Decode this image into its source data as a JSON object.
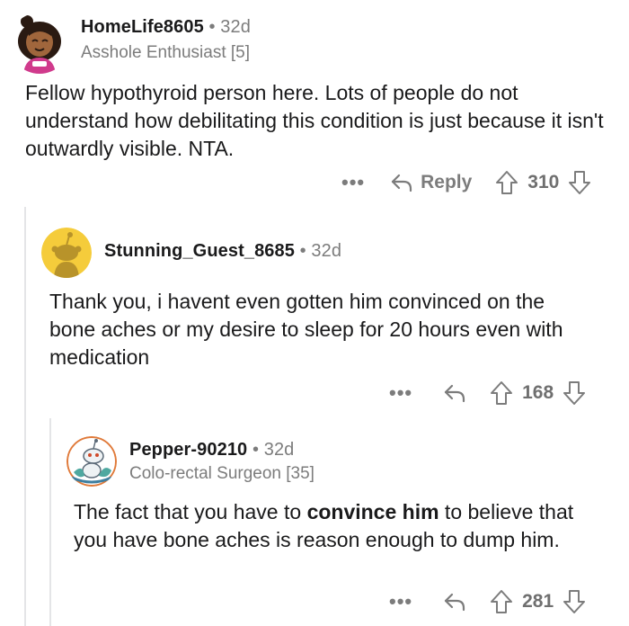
{
  "comments": [
    {
      "username": "HomeLife8605",
      "separator": "•",
      "age": "32d",
      "flair": "Asshole Enthusiast [5]",
      "body": "Fellow hypothyroid person here. Lots of people do not understand how debilitating this condition is just because it isn't outwardly visible. NTA.",
      "more_label": "•••",
      "reply_label": "Reply",
      "score": "310"
    },
    {
      "username": "Stunning_Guest_8685",
      "separator": "•",
      "age": "32d",
      "body": "Thank you, i havent even gotten him convinced on the bone aches or my desire to sleep for 20 hours even with medication",
      "more_label": "•••",
      "score": "168"
    },
    {
      "username": "Pepper-90210",
      "separator": "•",
      "age": "32d",
      "flair": "Colo-rectal Surgeon [35]",
      "body_before": "The fact that you have to ",
      "body_bold": "convince him",
      "body_after": " to believe that you have bone aches is reason enough to dump him.",
      "more_label": "•••",
      "score": "281"
    }
  ],
  "colors": {
    "meta_gray": "#7c7c7c",
    "thread_line": "#e4e5e7",
    "snoo_yellow": "#f5cc3b",
    "avatar3_ring": "#e07a3a"
  }
}
